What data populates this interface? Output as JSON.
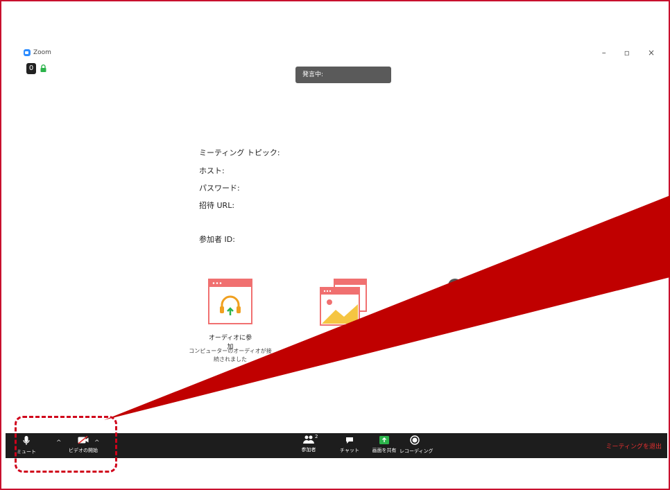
{
  "window": {
    "app_title": "Zoom",
    "controls": {
      "minimize": "–",
      "restore": "▫",
      "close": "×"
    },
    "recording_badge": "0"
  },
  "speaking_label": "発言中:",
  "meeting_info": {
    "topic_label": "ミーティング トピック:",
    "host_label": "ホスト:",
    "password_label": "パスワード:",
    "invite_url_label": "招待 URL:",
    "participant_id_label": "参加者 ID:"
  },
  "features": [
    {
      "label": "オーディオに参加",
      "desc_line1": "コンピューターのオーディオが接",
      "desc_line2": "続されました"
    }
  ],
  "toolbar": {
    "mute_label": "ミュート",
    "video_label": "ビデオの開始",
    "participants_label": "参加者",
    "participants_count": "2",
    "chat_label": "チャット",
    "share_label": "画面を共有",
    "record_label": "レコーディング",
    "leave_label": "ミーティングを退出"
  },
  "colors": {
    "annotation_red": "#c00000",
    "zoom_blue": "#2d8cff",
    "share_green": "#2bb34a",
    "leave_red": "#e53030"
  }
}
